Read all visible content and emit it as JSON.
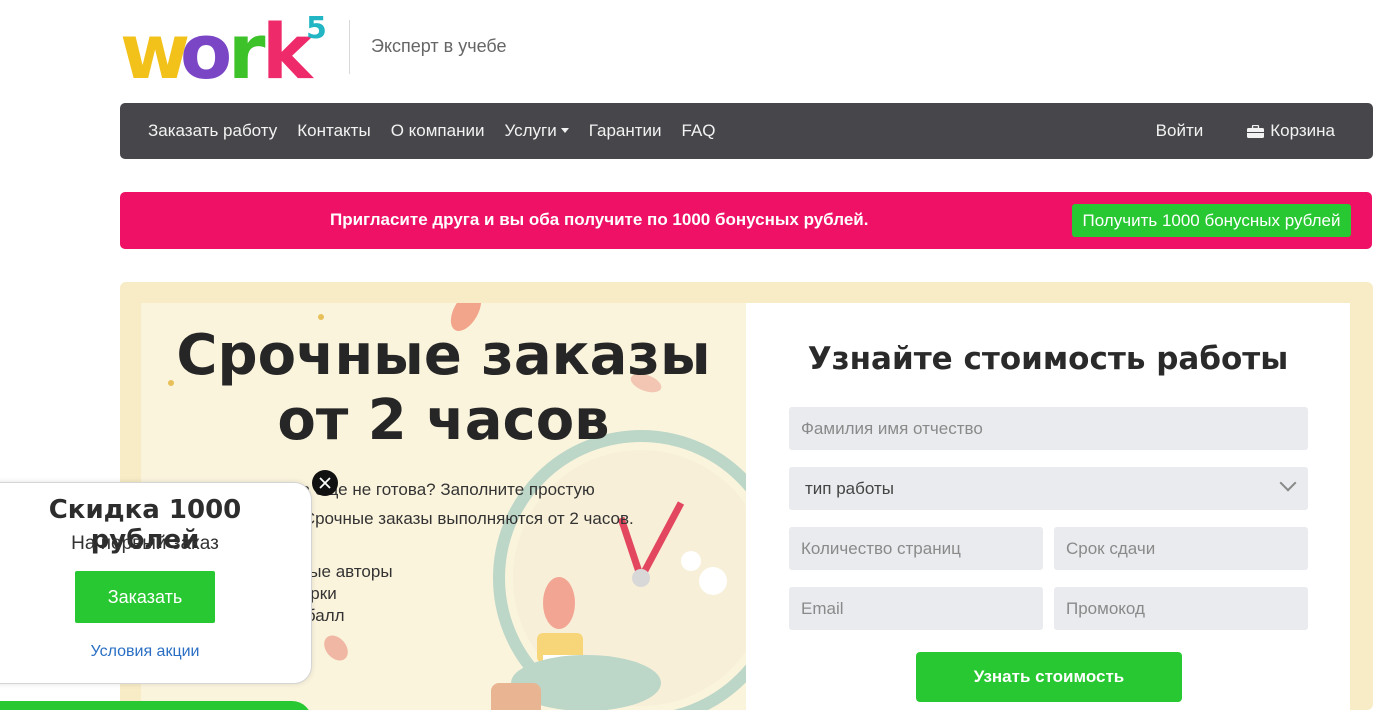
{
  "header": {
    "logo_text": "work",
    "logo_superscript": "5",
    "tagline": "Эксперт в учебе"
  },
  "nav": {
    "items": [
      "Заказать работу",
      "Контакты",
      "О компании",
      "Услуги",
      "Гарантии",
      "FAQ"
    ],
    "login": "Войти",
    "cart": "Корзина"
  },
  "promo": {
    "text": "Пригласите друга и вы оба получите по 1000 бонусных рублей.",
    "button": "Получить 1000 бонусных рублей"
  },
  "hero": {
    "title_line1": "Срочные заказы",
    "title_line2": "от 2 часов",
    "description_line1": "Дедлайн, а работа еще не готова? Заполните простую",
    "description_line2": "форму на Work5. Срочные заказы выполняются от 2 часов.",
    "features": [
      "Квалифицированные авторы",
      "Бесплатные проверки",
      "Высокий средний балл"
    ]
  },
  "form": {
    "title": "Узнайте стоимость работы",
    "name_placeholder": "Фамилия имя отчество",
    "work_type": "тип работы",
    "pages_placeholder": "Количество страниц",
    "deadline_placeholder": "Срок сдачи",
    "email_placeholder": "Email",
    "promo_placeholder": "Промокод",
    "submit": "Узнать стоимость"
  },
  "popup": {
    "title": "Скидка 1000 рублей",
    "subtitle": "На первый заказ",
    "button": "Заказать",
    "link": "Условия акции"
  },
  "colors": {
    "navbar": "#47474b",
    "promo_bg": "#ee1166",
    "accent_green": "#28c832",
    "hero_bg": "#f8ecc6"
  }
}
